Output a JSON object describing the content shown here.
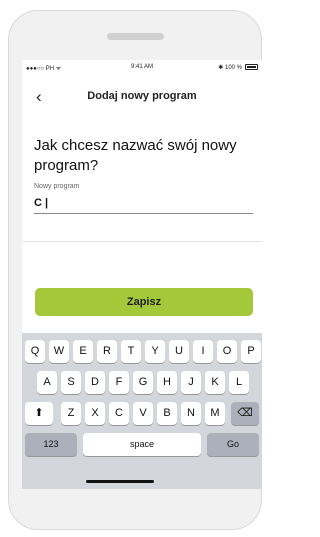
{
  "status": {
    "left": "●●●○○ PH ᯤ",
    "time": "9:41 AM",
    "right": "✱ 100 %"
  },
  "header": {
    "back_glyph": "‹",
    "title": "Dodaj nowy program"
  },
  "form": {
    "question": "Jak chcesz nazwać swój nowy program?",
    "field_label": "Nowy program",
    "field_value": "C |"
  },
  "save_label": "Zapisz",
  "keyboard": {
    "row1": [
      "Q",
      "W",
      "E",
      "R",
      "T",
      "Y",
      "U",
      "I",
      "O",
      "P"
    ],
    "row2": [
      "A",
      "S",
      "D",
      "F",
      "G",
      "H",
      "J",
      "K",
      "L"
    ],
    "row3": [
      "Z",
      "X",
      "C",
      "V",
      "B",
      "N",
      "M"
    ],
    "shift_glyph": "⬆",
    "delete_glyph": "⌫",
    "numbers_label": "123",
    "space_label": "space",
    "go_label": "Go"
  },
  "colors": {
    "accent": "#a3c83a",
    "keyboard_bg": "#d3d6db"
  }
}
